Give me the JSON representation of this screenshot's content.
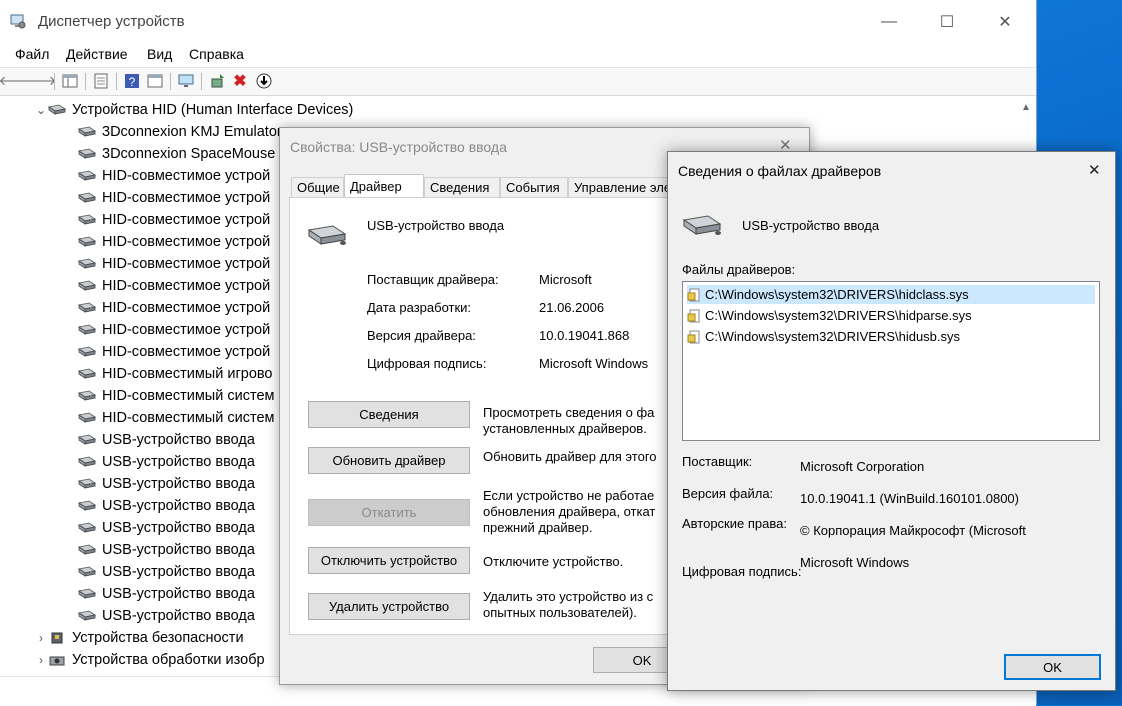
{
  "main_window": {
    "title": "Диспетчер устройств",
    "controls": {
      "minimize": "—",
      "maximize": "☐",
      "close": "✕"
    },
    "menu": [
      "Файл",
      "Действие",
      "Вид",
      "Справка"
    ],
    "tree": {
      "group_hid": "Устройства HID (Human Interface Devices)",
      "children": [
        "3Dconnexion KMJ Emulator",
        "3Dconnexion SpaceMouse",
        "HID-совместимое устрой",
        "HID-совместимое устрой",
        "HID-совместимое устрой",
        "HID-совместимое устрой",
        "HID-совместимое устрой",
        "HID-совместимое устрой",
        "HID-совместимое устрой",
        "HID-совместимое устрой",
        "HID-совместимое устрой",
        "HID-совместимый игрово",
        "HID-совместимый систем",
        "HID-совместимый систем",
        "USB-устройство ввода",
        "USB-устройство ввода",
        "USB-устройство ввода",
        "USB-устройство ввода",
        "USB-устройство ввода",
        "USB-устройство ввода",
        "USB-устройство ввода",
        "USB-устройство ввода",
        "USB-устройство ввода"
      ],
      "group_security": "Устройства безопасности",
      "group_image": "Устройства обработки изобр"
    }
  },
  "properties_dialog": {
    "title": "Свойства: USB-устройство ввода",
    "tabs": [
      "Общие",
      "Драйвер",
      "Сведения",
      "События",
      "Управление эле"
    ],
    "device_name": "USB-устройство ввода",
    "fields": [
      {
        "label": "Поставщик драйвера:",
        "value": "Microsoft"
      },
      {
        "label": "Дата разработки:",
        "value": "21.06.2006"
      },
      {
        "label": "Версия драйвера:",
        "value": "10.0.19041.868"
      },
      {
        "label": "Цифровая подпись:",
        "value": "Microsoft Windows"
      }
    ],
    "actions": [
      {
        "button": "Сведения",
        "desc": "Просмотреть сведения о фа\nустановленных драйверов."
      },
      {
        "button": "Обновить драйвер",
        "desc": "Обновить драйвер для этого"
      },
      {
        "button": "Откатить",
        "desc": "Если устройство не работае\nобновления драйвера, откат\nпрежний драйвер."
      },
      {
        "button": "Отключить устройство",
        "desc": "Отключите устройство."
      },
      {
        "button": "Удалить устройство",
        "desc": "Удалить это устройство из с\nопытных пользователей)."
      }
    ],
    "ok": "OK",
    "close": "✕"
  },
  "driver_files_dialog": {
    "title": "Сведения о файлах драйверов",
    "device_name": "USB-устройство ввода",
    "files_label": "Файлы драйверов:",
    "files": [
      "C:\\Windows\\system32\\DRIVERS\\hidclass.sys",
      "C:\\Windows\\system32\\DRIVERS\\hidparse.sys",
      "C:\\Windows\\system32\\DRIVERS\\hidusb.sys"
    ],
    "provider_label": "Поставщик:",
    "provider_value": "Microsoft Corporation",
    "version_label": "Версия файла:",
    "version_value": "10.0.19041.1 (WinBuild.160101.0800)",
    "copyright_label": "Авторские права:",
    "copyright_value": "© Корпорация Майкрософт (Microsoft",
    "signature_label": "Цифровая подпись:",
    "signature_value": "Microsoft Windows",
    "ok": "OK",
    "close": "✕"
  }
}
